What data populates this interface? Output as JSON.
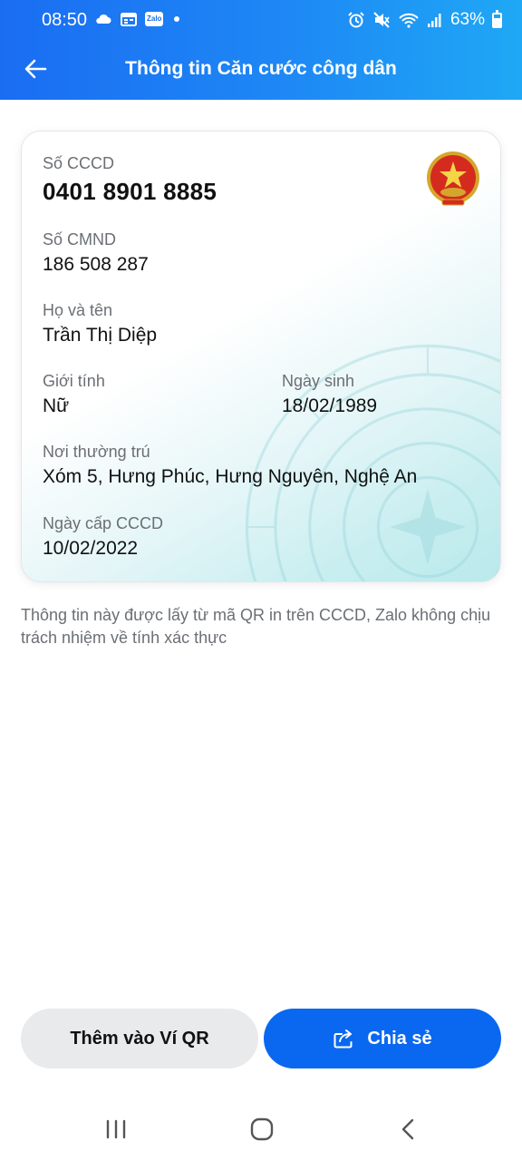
{
  "status_bar": {
    "time": "08:50",
    "battery": "63%",
    "left_icons": [
      "cloud-icon",
      "calendar-icon",
      "zalo-icon",
      "dot-icon"
    ],
    "zalo_badge": "Zalo",
    "right_icons": [
      "alarm-icon",
      "mute-icon",
      "wifi-icon",
      "signal-icon",
      "battery-icon"
    ],
    "battery_level": 0.63
  },
  "header": {
    "title": "Thông tin Căn cước công dân",
    "back_icon": "arrow-left-icon"
  },
  "card": {
    "cccd_label": "Số CCCD",
    "cccd_value": "0401 8901 8885",
    "cmnd_label": "Số CMND",
    "cmnd_value": "186 508 287",
    "name_label": "Họ và tên",
    "name_value": "Trần Thị Diệp",
    "gender_label": "Giới tính",
    "gender_value": "Nữ",
    "dob_label": "Ngày sinh",
    "dob_value": "18/02/1989",
    "address_label": "Nơi thường trú",
    "address_value": "Xóm 5, Hưng Phúc, Hưng Nguyên, Nghệ An",
    "issue_label": "Ngày cấp CCCD",
    "issue_value": "10/02/2022",
    "emblem_icon": "vietnam-emblem-icon"
  },
  "disclaimer": "Thông tin này được lấy từ mã QR in trên CCCD, Zalo không chịu trách nhiệm về tính xác thực",
  "actions": {
    "add_wallet_label": "Thêm vào Ví QR",
    "share_label": "Chia sẻ",
    "share_icon": "share-icon"
  },
  "system_nav": [
    "recents-icon",
    "home-icon",
    "back-icon"
  ],
  "colors": {
    "header_start": "#1a6df2",
    "header_end": "#1fa8f5",
    "primary_button": "#0a68f0",
    "secondary_button": "#e9eaec"
  }
}
